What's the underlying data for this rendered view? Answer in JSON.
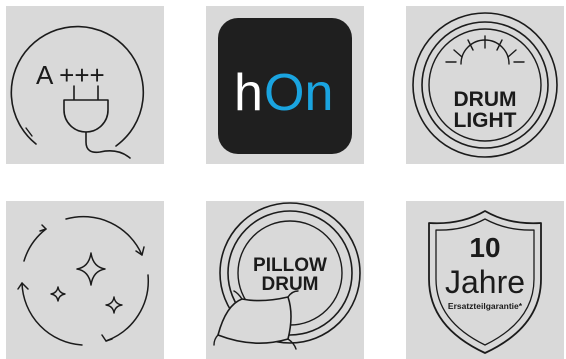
{
  "tiles": [
    {
      "name": "energy-class",
      "label": "A +++",
      "icon": "plug-icon"
    },
    {
      "name": "hon-app",
      "logo_h": "h",
      "logo_on": "On",
      "colors": {
        "bg": "#1f1f1f",
        "h": "#ffffff",
        "on": "#1aa4e0"
      }
    },
    {
      "name": "drum-light",
      "line1": "DRUM",
      "line2": "LIGHT"
    },
    {
      "name": "steam-care",
      "icon": "sparkle-cycle-icon"
    },
    {
      "name": "pillow-drum",
      "line1": "PILLOW",
      "line2": "DRUM",
      "icon": "pillow-icon"
    },
    {
      "name": "warranty",
      "number": "10",
      "word": "Jahre",
      "caption": "Ersatzteilgarantie*",
      "icon": "shield-icon"
    }
  ]
}
